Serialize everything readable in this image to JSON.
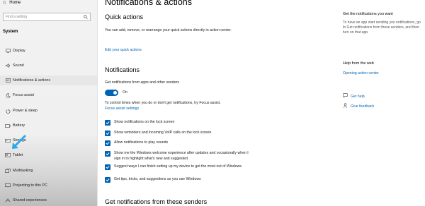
{
  "sidebar": {
    "home_label": "Home",
    "search_placeholder": "Find a setting",
    "section_title": "System",
    "items": [
      {
        "label": "Display",
        "icon": "display-icon"
      },
      {
        "label": "Sound",
        "icon": "sound-icon"
      },
      {
        "label": "Notifications & actions",
        "icon": "notifications-icon"
      },
      {
        "label": "Focus assist",
        "icon": "focus-assist-icon"
      },
      {
        "label": "Power & sleep",
        "icon": "power-icon"
      },
      {
        "label": "Battery",
        "icon": "battery-icon"
      },
      {
        "label": "Storage",
        "icon": "storage-icon"
      },
      {
        "label": "Tablet",
        "icon": "tablet-icon"
      },
      {
        "label": "Multitasking",
        "icon": "multitasking-icon"
      },
      {
        "label": "Projecting to this PC",
        "icon": "projecting-icon"
      },
      {
        "label": "Shared experiences",
        "icon": "shared-experiences-icon"
      }
    ],
    "selected": "Notifications & actions"
  },
  "main": {
    "title": "Notifications & actions",
    "quick_actions": {
      "heading": "Quick actions",
      "description": "You can add, remove, or rearrange your quick actions directly in action center.",
      "link": "Edit your quick actions"
    },
    "notifications": {
      "heading": "Notifications",
      "toggle_caption": "Get notifications from apps and other senders",
      "toggle_state": "On",
      "focus_text": "To control times when you do or don't get notifications, try Focus assist.",
      "focus_link": "Focus assist settings",
      "checkboxes": [
        {
          "label": "Show notifications on the lock screen",
          "checked": true
        },
        {
          "label": "Show reminders and incoming VoIP calls on the lock screen",
          "checked": true
        },
        {
          "label": "Allow notifications to play sounds",
          "checked": true
        },
        {
          "label": "Show me the Windows welcome experience after updates and occasionally when I sign in to highlight what's new and suggested",
          "checked": true
        },
        {
          "label": "Suggest ways I can finish setting up my device to get the most out of Windows",
          "checked": true
        },
        {
          "label": "Get tips, tricks, and suggestions as you use Windows",
          "checked": true
        }
      ]
    },
    "senders_heading": "Get notifications from these senders"
  },
  "right": {
    "want_heading": "Get the notifications you want",
    "want_text": "To have an app start sending you notifications, go to Get notifications from these senders, and then turn on that app.",
    "help_heading": "Help from the web",
    "help_link": "Opening action center",
    "get_help": "Get help",
    "give_feedback": "Give feedback"
  },
  "colors": {
    "accent": "#0063b1",
    "link": "#0066b4"
  }
}
